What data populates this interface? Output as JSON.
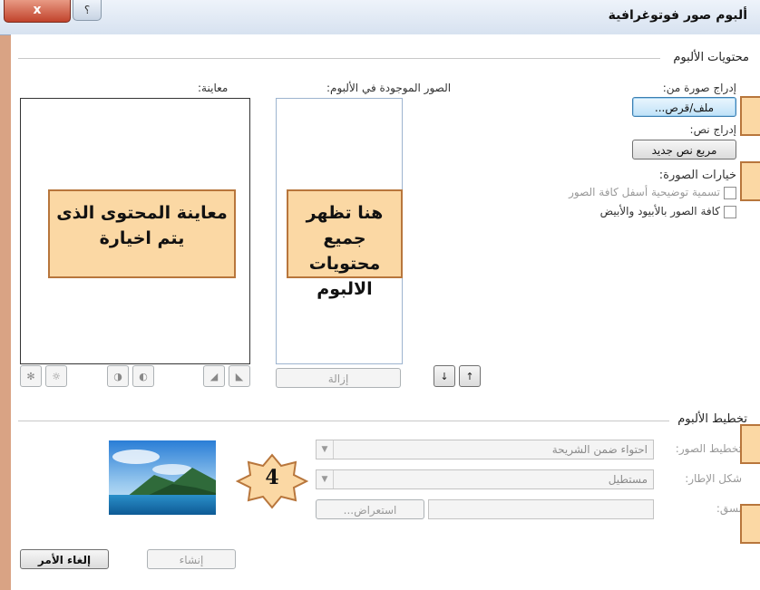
{
  "window": {
    "title": "ألبوم صور فوتوغرافية",
    "close_label": "x",
    "help_label": "؟"
  },
  "album_content": {
    "section_label": "محتويات الألبوم",
    "insert_picture_from_label": "إدراج صورة من:",
    "file_disk_button": "ملف/قرص...",
    "insert_text_label": "إدراج نص:",
    "new_text_box_button": "مربع نص جديد",
    "picture_options_label": "خيارات الصورة:",
    "captions_below_option": "تسمية توضيحية أسفل كافة الصور",
    "black_white_option": "كافة الصور بالأبيود والأبيض",
    "pictures_in_album_label": "الصور الموجودة في الألبوم:",
    "preview_label": "معاينة:",
    "remove_button": "إزالة",
    "move_up_label": "↑",
    "move_down_label": "↓"
  },
  "callouts": {
    "album_contents_note": "هنا تظهر جميع محتويات الالبوم",
    "preview_note": "معاينة المحتوى الذى يتم اخيارة",
    "number_label": "4"
  },
  "album_layout": {
    "section_label": "تخطيط الألبوم",
    "picture_layout_label": "تخطيط الصور:",
    "picture_layout_value": "احتواء ضمن الشريحة",
    "frame_shape_label": "شكل الإطار:",
    "frame_shape_value": "مستطيل",
    "theme_label": "نسق:",
    "theme_value": "",
    "browse_button": "استعراض..."
  },
  "footer": {
    "create_button": "إنشاء",
    "cancel_button": "إلغاء الأمر"
  }
}
